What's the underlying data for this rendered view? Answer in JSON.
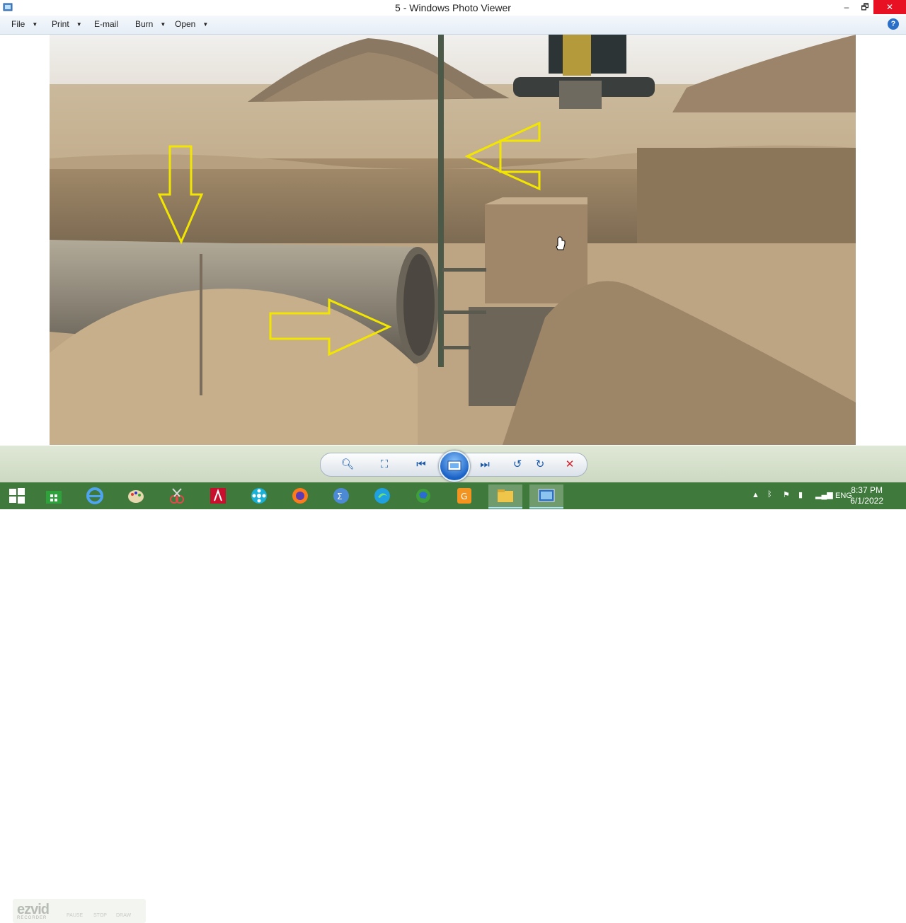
{
  "window": {
    "title": "5 - Windows Photo Viewer",
    "minimize": "‒",
    "maximize": "🗗",
    "close": "✕"
  },
  "menu": {
    "file": "File",
    "print": "Print",
    "email": "E-mail",
    "burn": "Burn",
    "open": "Open",
    "help": "?"
  },
  "ezvid": {
    "logo": "ezvid",
    "sub": "RECORDER",
    "pause": "PAUSE",
    "stop": "STOP",
    "draw": "DRAW"
  },
  "tray": {
    "language": "ENG",
    "time": "8:37 PM",
    "date": "6/1/2022"
  },
  "colors": {
    "taskbar": "#3f7a3c",
    "arrow": "#f2e600",
    "sky": "#e6e4df",
    "sand": "#c2a882"
  }
}
